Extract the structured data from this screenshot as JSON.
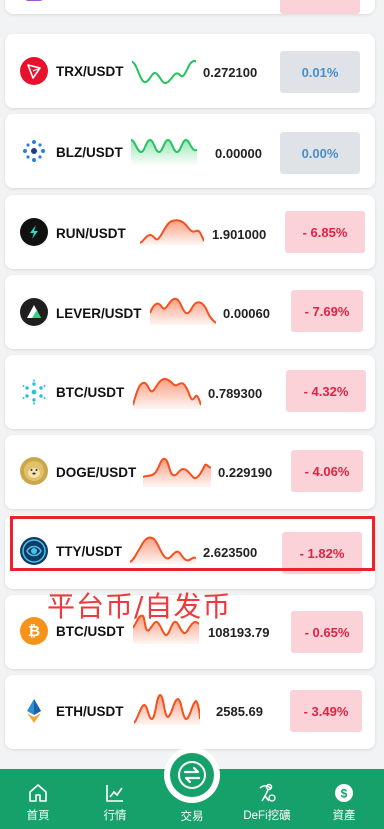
{
  "markets": [
    {
      "id": "top",
      "pair": "",
      "price": "",
      "change": "",
      "trend": "neg",
      "icon": "purple-coin-icon"
    },
    {
      "id": "trx",
      "pair": "TRX/USDT",
      "price": "0.272100",
      "change": "0.01%",
      "trend": "zero",
      "icon": "tron-logo-icon"
    },
    {
      "id": "blz",
      "pair": "BLZ/USDT",
      "price": "0.00000",
      "change": "0.00%",
      "trend": "zero",
      "icon": "bluzelle-logo-icon"
    },
    {
      "id": "run",
      "pair": "RUN/USDT",
      "price": "1.901000",
      "change": "- 6.85%",
      "trend": "neg",
      "icon": "run-logo-icon"
    },
    {
      "id": "lever",
      "pair": "LEVER/USDT",
      "price": "0.00060",
      "change": "- 7.69%",
      "trend": "neg",
      "icon": "lever-logo-icon"
    },
    {
      "id": "btc1",
      "pair": "BTC/USDT",
      "price": "0.789300",
      "change": "- 4.32%",
      "trend": "neg",
      "icon": "cardano-style-logo-icon"
    },
    {
      "id": "doge",
      "pair": "DOGE/USDT",
      "price": "0.229190",
      "change": "- 4.06%",
      "trend": "neg",
      "icon": "doge-logo-icon"
    },
    {
      "id": "tty",
      "pair": "TTY/USDT",
      "price": "2.623500",
      "change": "- 1.82%",
      "trend": "neg",
      "icon": "tty-logo-icon"
    },
    {
      "id": "btc2",
      "pair": "BTC/USDT",
      "price": "108193.79",
      "change": "- 0.65%",
      "trend": "neg",
      "icon": "bitcoin-logo-icon"
    },
    {
      "id": "eth",
      "pair": "ETH/USDT",
      "price": "2585.69",
      "change": "- 3.49%",
      "trend": "neg",
      "icon": "ethereum-logo-icon"
    }
  ],
  "annotation": "平台币/自发币",
  "tabs": {
    "home": {
      "label": "首頁",
      "icon": "home-icon"
    },
    "market": {
      "label": "行情",
      "icon": "chart-icon"
    },
    "trade": {
      "label": "交易",
      "icon": "swap-icon"
    },
    "defi": {
      "label": "DeFi挖礦",
      "icon": "miner-icon"
    },
    "assets": {
      "label": "資產",
      "icon": "dollar-icon"
    }
  },
  "colors": {
    "up": "#22c55e",
    "down": "#f4511e",
    "tabbar": "#16a06a",
    "neg_text": "#e02342",
    "zero_text": "#4a8fc8"
  }
}
